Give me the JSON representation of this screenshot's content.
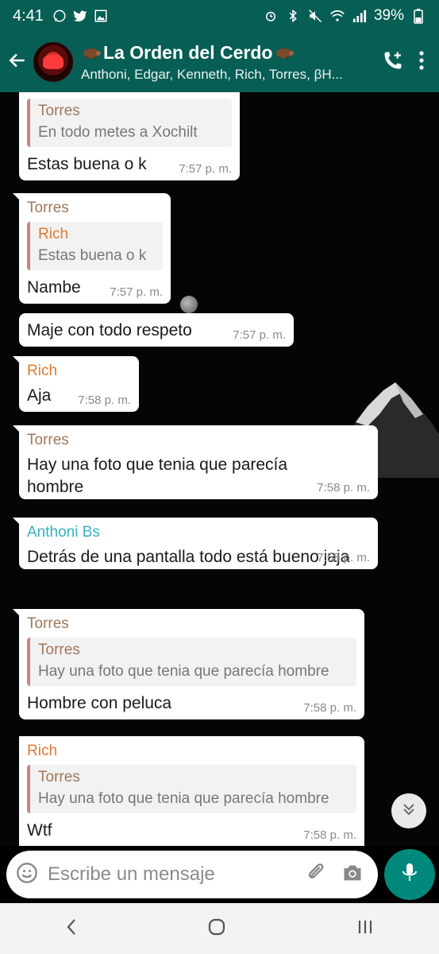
{
  "status_bar": {
    "time": "4:41",
    "battery": "39%"
  },
  "header": {
    "group_name": "La Orden del Cerdo",
    "members": "Anthoni, Edgar, Kenneth, Rich, Torres, βH..."
  },
  "messages": [
    {
      "quote_sender": "Torres",
      "quote_text": "En todo metes a Xochilt",
      "text": "Estas buena o k",
      "time": "7:57 p. m."
    },
    {
      "sender": "Torres",
      "quote_sender": "Rich",
      "quote_text": "Estas buena o k",
      "text": "Nambe",
      "time": "7:57 p. m."
    },
    {
      "text": "Maje con todo respeto",
      "time": "7:57 p. m."
    },
    {
      "sender": "Rich",
      "text": "Aja",
      "time": "7:58 p. m."
    },
    {
      "sender": "Torres",
      "text": "Hay una foto que tenia que parecía hombre",
      "time": "7:58 p. m."
    },
    {
      "sender": "Anthoni Bs",
      "text": "Detrás de una pantalla todo está bueno jaja",
      "time": "7:58 p. m."
    },
    {
      "sender": "Torres",
      "quote_sender": "Torres",
      "quote_text": "Hay una foto que tenia que parecía hombre",
      "text": "Hombre con peluca",
      "time": "7:58 p. m."
    },
    {
      "sender": "Rich",
      "quote_sender": "Torres",
      "quote_text": "Hay una foto que tenia que parecía hombre",
      "text": "Wtf",
      "time": "7:58 p. m."
    }
  ],
  "composer": {
    "placeholder": "Escribe un mensaje"
  },
  "colors": {
    "header": "#075e54",
    "mic": "#00897b",
    "torres": "#a1775b",
    "rich": "#e07a2f",
    "anthoni": "#38b1c1"
  },
  "icons": [
    "whatsapp-icon",
    "twitter-icon",
    "gallery-icon",
    "alarm-icon",
    "bluetooth-icon",
    "mute-icon",
    "wifi-icon",
    "signal-icon",
    "battery-icon",
    "back-arrow-icon",
    "add-call-icon",
    "more-vert-icon",
    "emoji-icon",
    "attach-icon",
    "camera-icon",
    "mic-icon",
    "chevron-double-down-icon",
    "nav-back-icon",
    "nav-home-icon",
    "nav-recents-icon"
  ]
}
